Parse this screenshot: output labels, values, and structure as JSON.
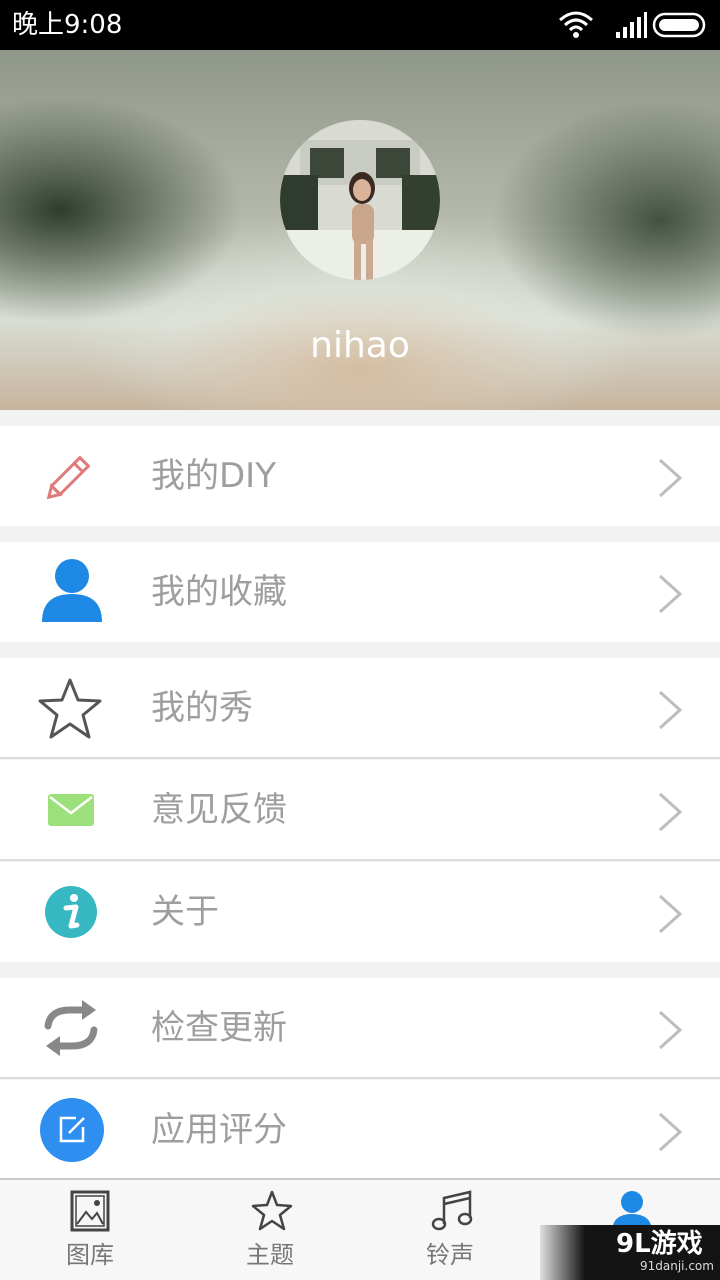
{
  "status_bar": {
    "time": "晚上9:08"
  },
  "profile": {
    "username": "nihao"
  },
  "menu": {
    "diy": "我的DIY",
    "favorites": "我的收藏",
    "show": "我的秀",
    "feedback": "意见反馈",
    "about": "关于",
    "check_update": "检查更新",
    "rate_app": "应用评分"
  },
  "icons": {
    "diy": "pencil-icon",
    "favorites": "person-icon",
    "show": "star-icon",
    "feedback": "envelope-icon",
    "about": "info-icon",
    "check_update": "refresh-icon",
    "rate_app": "edit-icon",
    "chevron": "chevron-right-icon"
  },
  "bottom_nav": {
    "gallery": "图库",
    "theme": "主题",
    "ringtone": "铃声"
  },
  "watermark": {
    "main": "9L游戏",
    "sub": "91danji.com"
  },
  "colors": {
    "accent_blue": "#1e88e5",
    "feedback_green": "#9be07a",
    "info_teal": "#36b7c2",
    "pencil_red": "#e07a7a",
    "label_gray": "#9e9e9e"
  }
}
